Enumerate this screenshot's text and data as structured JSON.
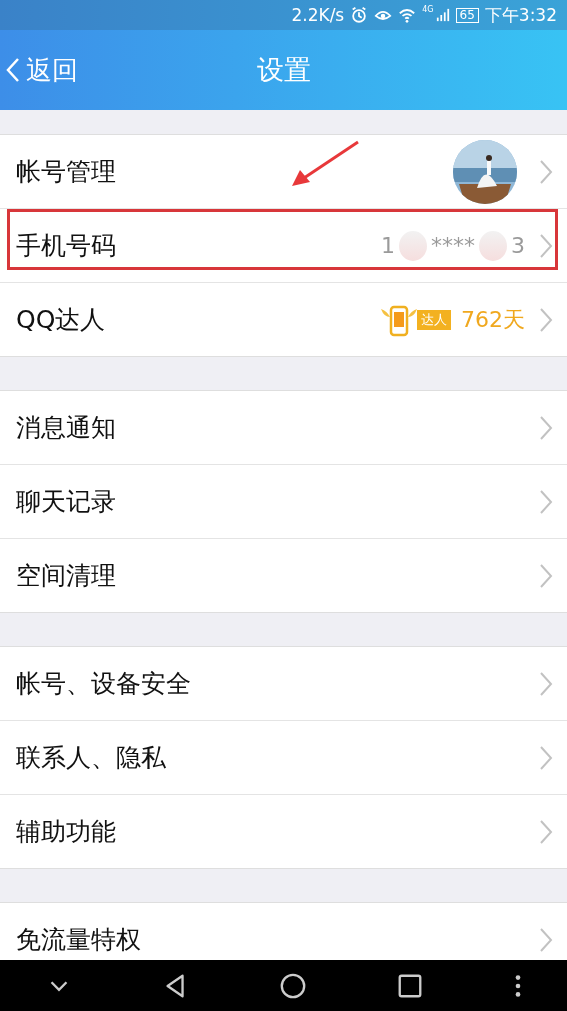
{
  "status_bar": {
    "speed": "2.2K/s",
    "network": "4G",
    "battery": "65",
    "time": "下午3:32"
  },
  "header": {
    "back": "返回",
    "title": "设置"
  },
  "sections": [
    {
      "items": [
        {
          "kind": "avatar",
          "label": "帐号管理"
        },
        {
          "kind": "phone",
          "label": "手机号码",
          "phone": {
            "start": "1",
            "middle": "****",
            "end": "3"
          },
          "highlighted": true
        },
        {
          "kind": "badge",
          "label": "QQ达人",
          "badge": "达人",
          "days": "762天"
        }
      ]
    },
    {
      "items": [
        {
          "kind": "plain",
          "label": "消息通知"
        },
        {
          "kind": "plain",
          "label": "聊天记录"
        },
        {
          "kind": "plain",
          "label": "空间清理"
        }
      ]
    },
    {
      "items": [
        {
          "kind": "plain",
          "label": "帐号、设备安全"
        },
        {
          "kind": "plain",
          "label": "联系人、隐私"
        },
        {
          "kind": "plain",
          "label": "辅助功能"
        }
      ]
    },
    {
      "items": [
        {
          "kind": "plain",
          "label": "免流量特权"
        }
      ]
    }
  ]
}
